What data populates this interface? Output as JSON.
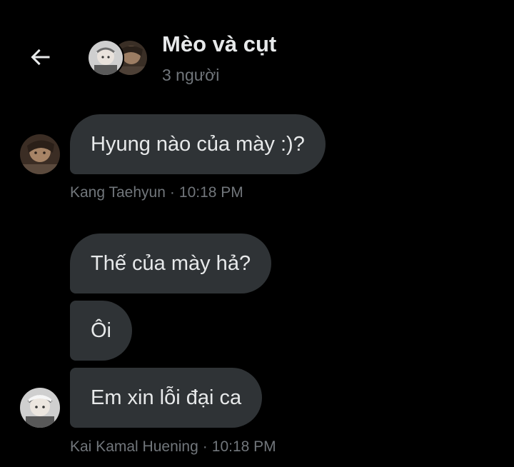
{
  "header": {
    "back_icon": "arrow-left-icon",
    "title": "Mèo và cụt",
    "subtitle": "3 người"
  },
  "messages": [
    {
      "text": "Hyung nào của mày :)?",
      "author": "Kang Taehyun",
      "time": "10:18 PM"
    },
    {
      "text": "Thế của mày hả?"
    },
    {
      "text": "Ôi"
    },
    {
      "text": "Em xin lỗi đại ca",
      "author": "Kai Kamal Huening",
      "time": "10:18 PM"
    }
  ],
  "meta_separator": "·",
  "colors": {
    "background": "#000000",
    "bubble": "#2f3336",
    "text_primary": "#e7e9ea",
    "text_secondary": "#71767b"
  }
}
